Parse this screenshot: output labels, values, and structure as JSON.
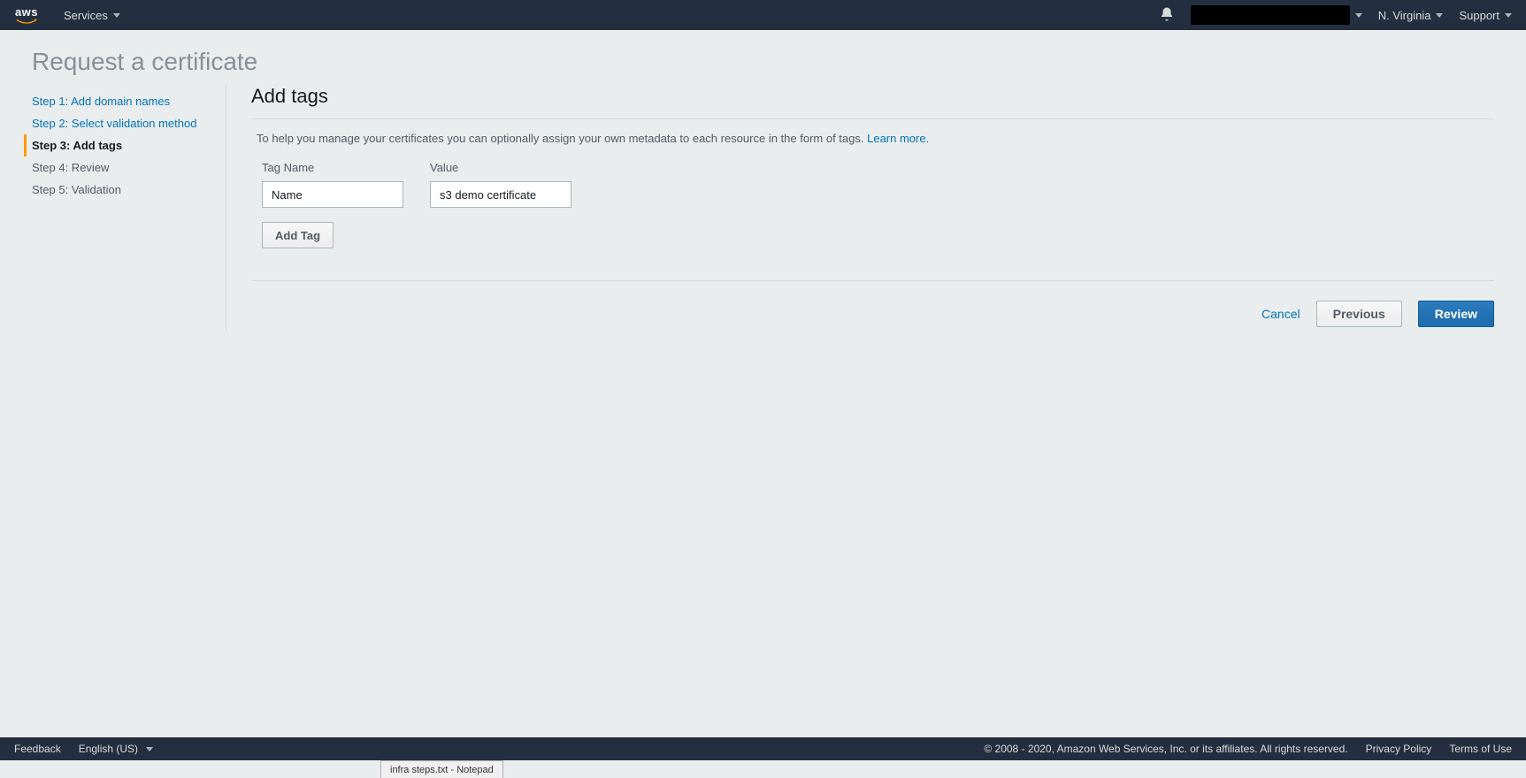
{
  "topnav": {
    "services_label": "Services",
    "region_label": "N. Virginia",
    "support_label": "Support"
  },
  "page_title": "Request a certificate",
  "sidebar": {
    "steps": [
      {
        "label": "Step 1: Add domain names",
        "state": "completed"
      },
      {
        "label": "Step 2: Select validation method",
        "state": "completed"
      },
      {
        "label": "Step 3: Add tags",
        "state": "active"
      },
      {
        "label": "Step 4: Review",
        "state": "upcoming"
      },
      {
        "label": "Step 5: Validation",
        "state": "upcoming"
      }
    ]
  },
  "main": {
    "section_title": "Add tags",
    "description": "To help you manage your certificates you can optionally assign your own metadata to each resource in the form of tags. ",
    "learn_more": "Learn more.",
    "tag_name_header": "Tag Name",
    "tag_value_header": "Value",
    "tags": [
      {
        "name": "Name",
        "value": "s3 demo certificate"
      }
    ],
    "add_tag_label": "Add Tag"
  },
  "actions": {
    "cancel": "Cancel",
    "previous": "Previous",
    "review": "Review"
  },
  "footer": {
    "feedback": "Feedback",
    "language": "English (US)",
    "copyright": "© 2008 - 2020, Amazon Web Services, Inc. or its affiliates. All rights reserved.",
    "privacy": "Privacy Policy",
    "terms": "Terms of Use"
  },
  "taskbar": {
    "notepad_tab": "infra steps.txt - Notepad"
  }
}
